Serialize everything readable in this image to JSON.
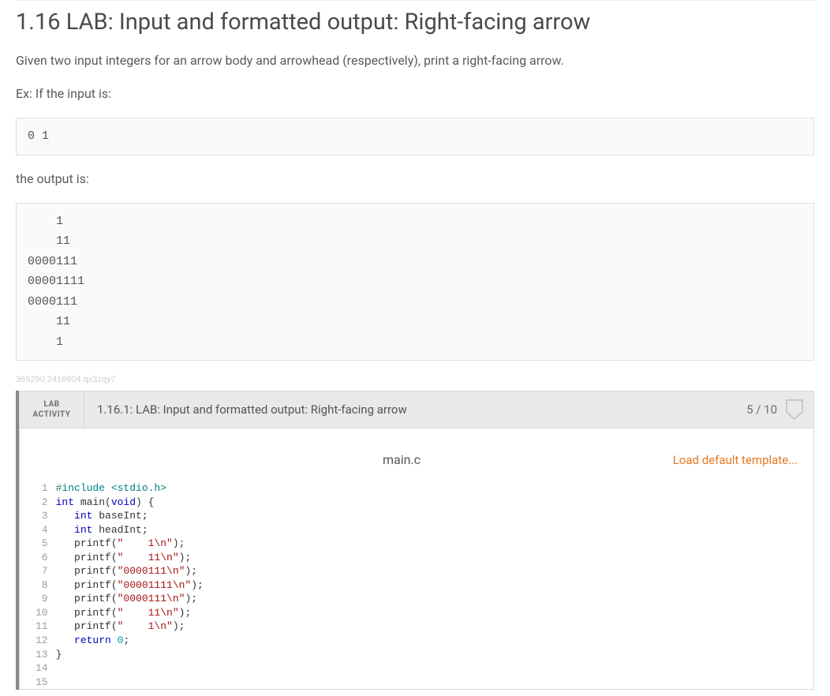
{
  "title": "1.16 LAB: Input and formatted output: Right-facing arrow",
  "instruction": "Given two input integers for an arrow body and arrowhead (respectively), print a right-facing arrow.",
  "example_label": "Ex: If the input is:",
  "example_input": "0 1",
  "output_label": "the output is:",
  "example_output": "    1\n    11\n0000111\n00001111\n0000111\n    11\n    1",
  "watermark": "365290.2416604.qx3zqy7",
  "lab": {
    "tag_line1": "LAB",
    "tag_line2": "ACTIVITY",
    "title": "1.16.1: LAB: Input and formatted output: Right-facing arrow",
    "score": "5 / 10"
  },
  "editor": {
    "filename": "main.c",
    "load_template": "Load default template...",
    "visible_lines": 15,
    "code": {
      "lines": [
        {
          "n": 1,
          "tokens": [
            {
              "t": "#include <stdio.h>",
              "c": "pp"
            }
          ]
        },
        {
          "n": 2,
          "tokens": [
            {
              "t": "",
              "c": ""
            }
          ]
        },
        {
          "n": 3,
          "tokens": [
            {
              "t": "int",
              "c": "kw"
            },
            {
              "t": " main(",
              "c": ""
            },
            {
              "t": "void",
              "c": "kw"
            },
            {
              "t": ") {",
              "c": ""
            }
          ]
        },
        {
          "n": 4,
          "tokens": [
            {
              "t": "   ",
              "c": ""
            },
            {
              "t": "int",
              "c": "kw"
            },
            {
              "t": " baseInt;",
              "c": ""
            }
          ]
        },
        {
          "n": 5,
          "tokens": [
            {
              "t": "   ",
              "c": ""
            },
            {
              "t": "int",
              "c": "kw"
            },
            {
              "t": " headInt;",
              "c": ""
            }
          ]
        },
        {
          "n": 6,
          "tokens": [
            {
              "t": "",
              "c": ""
            }
          ]
        },
        {
          "n": 7,
          "tokens": [
            {
              "t": "   printf(",
              "c": ""
            },
            {
              "t": "\"    1\\n\"",
              "c": "str"
            },
            {
              "t": ");",
              "c": ""
            }
          ]
        },
        {
          "n": 8,
          "tokens": [
            {
              "t": "   printf(",
              "c": ""
            },
            {
              "t": "\"    11\\n\"",
              "c": "str"
            },
            {
              "t": ");",
              "c": ""
            }
          ]
        },
        {
          "n": 9,
          "tokens": [
            {
              "t": "   printf(",
              "c": ""
            },
            {
              "t": "\"0000111\\n\"",
              "c": "str"
            },
            {
              "t": ");",
              "c": ""
            }
          ]
        },
        {
          "n": 10,
          "tokens": [
            {
              "t": "   printf(",
              "c": ""
            },
            {
              "t": "\"00001111\\n\"",
              "c": "str"
            },
            {
              "t": ");",
              "c": ""
            }
          ]
        },
        {
          "n": 11,
          "tokens": [
            {
              "t": "   printf(",
              "c": ""
            },
            {
              "t": "\"0000111\\n\"",
              "c": "str"
            },
            {
              "t": ");",
              "c": ""
            }
          ]
        },
        {
          "n": 12,
          "tokens": [
            {
              "t": "   printf(",
              "c": ""
            },
            {
              "t": "\"    11\\n\"",
              "c": "str"
            },
            {
              "t": ");",
              "c": ""
            }
          ]
        },
        {
          "n": 13,
          "tokens": [
            {
              "t": "   printf(",
              "c": ""
            },
            {
              "t": "\"    1\\n\"",
              "c": "str"
            },
            {
              "t": ");",
              "c": ""
            }
          ]
        },
        {
          "n": 14,
          "tokens": [
            {
              "t": "   ",
              "c": ""
            },
            {
              "t": "return",
              "c": "kw"
            },
            {
              "t": " ",
              "c": ""
            },
            {
              "t": "0",
              "c": "num"
            },
            {
              "t": ";",
              "c": ""
            }
          ]
        },
        {
          "n": 15,
          "tokens": [
            {
              "t": "}",
              "c": ""
            }
          ]
        }
      ]
    }
  }
}
